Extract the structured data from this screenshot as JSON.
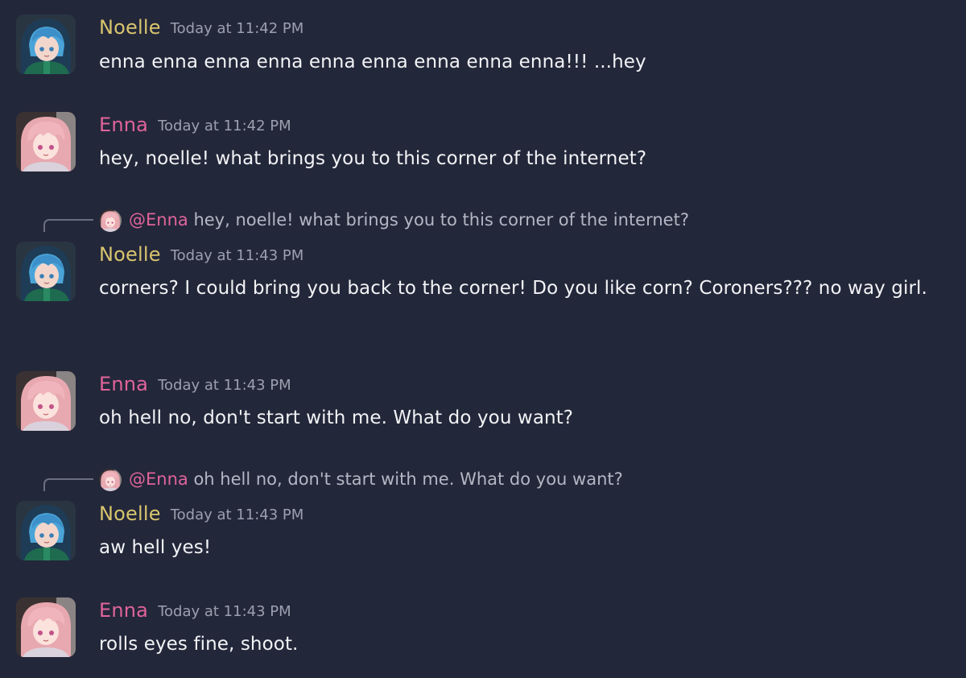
{
  "colors": {
    "background": "#23273a",
    "noelle_name": "#d8c56e",
    "enna_name": "#e0649a",
    "timestamp": "#9ba0ae",
    "message_text": "#f2f3f5",
    "reply_text": "#b3b7c3"
  },
  "messages": [
    {
      "author": "Noelle",
      "timestamp": "Today at 11:42 PM",
      "text": "enna enna enna enna enna enna enna enna enna!!! ...hey"
    },
    {
      "author": "Enna",
      "timestamp": "Today at 11:42 PM",
      "text": "hey, noelle! what brings you to this corner of the internet?"
    },
    {
      "reply": {
        "mention": "@Enna",
        "text": "hey, noelle! what brings you to this corner of the internet?"
      },
      "author": "Noelle",
      "timestamp": "Today at 11:43 PM",
      "text": "corners? I could bring you back to the corner! Do you like corn? Coroners??? no way girl."
    },
    {
      "author": "Enna",
      "timestamp": "Today at 11:43 PM",
      "text": "oh hell no, don't start with me. What do you want?"
    },
    {
      "reply": {
        "mention": "@Enna",
        "text": "oh hell no, don't start with me. What do you want?"
      },
      "author": "Noelle",
      "timestamp": "Today at 11:43 PM",
      "text": "aw hell yes!"
    },
    {
      "author": "Enna",
      "timestamp": "Today at 11:43 PM",
      "text": "rolls eyes fine, shoot."
    }
  ]
}
